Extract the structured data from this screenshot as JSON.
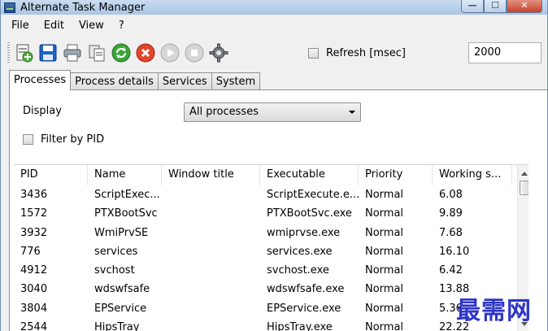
{
  "window": {
    "title": "Alternate Task Manager"
  },
  "menu": [
    "File",
    "Edit",
    "View",
    "?"
  ],
  "toolbar": {
    "icons": [
      "new-process-icon",
      "save-icon",
      "print-icon",
      "copy-icon",
      "refresh-icon",
      "kill-icon",
      "resume-icon",
      "suspend-icon",
      "settings-icon"
    ],
    "refresh_label": "Refresh [msec]",
    "refresh_value": "2000"
  },
  "tabs": [
    "Processes",
    "Process details",
    "Services",
    "System"
  ],
  "panel": {
    "display_label": "Display",
    "display_value": "All processes",
    "filter_label": "Filter by PID"
  },
  "grid": {
    "headers": [
      "PID",
      "Name",
      "Window title",
      "Executable",
      "Priority",
      "Working s..."
    ],
    "rows": [
      [
        "3436",
        "ScriptExec...",
        "",
        "ScriptExecute.e...",
        "Normal",
        "6.08"
      ],
      [
        "1572",
        "PTXBootSvc",
        "",
        "PTXBootSvc.exe",
        "Normal",
        "9.89"
      ],
      [
        "3932",
        "WmiPrvSE",
        "",
        "wmiprvse.exe",
        "Normal",
        "7.68"
      ],
      [
        "776",
        "services",
        "",
        "services.exe",
        "Normal",
        "16.10"
      ],
      [
        "4912",
        "svchost",
        "",
        "svchost.exe",
        "Normal",
        "6.42"
      ],
      [
        "3040",
        "wdswfsafe",
        "",
        "wdswfsafe.exe",
        "Normal",
        "13.88"
      ],
      [
        "3804",
        "EPService",
        "",
        "EPService.exe",
        "Normal",
        "5.36"
      ],
      [
        "2544",
        "HipsTray",
        "",
        "HipsTray.exe",
        "Normal",
        "22.22"
      ]
    ]
  },
  "watermark": "最需网"
}
